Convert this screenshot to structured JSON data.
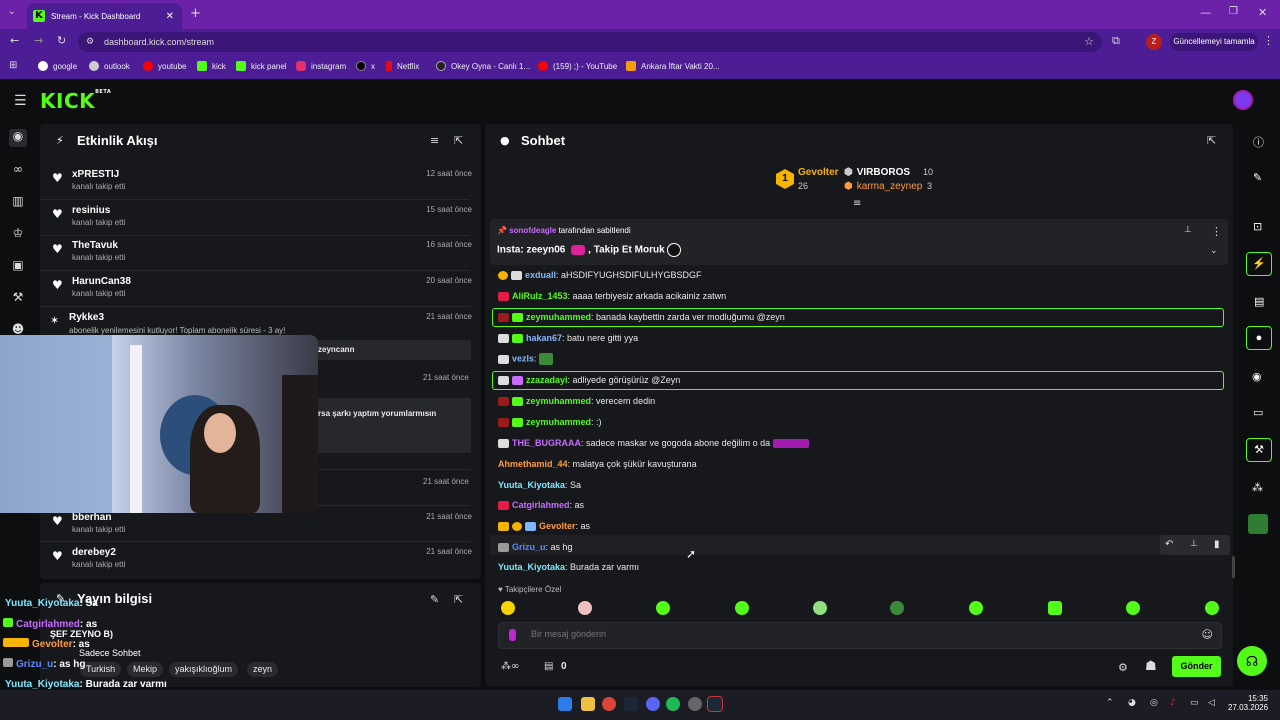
{
  "browser": {
    "tab_title": "Stream - Kick Dashboard",
    "url": "dashboard.kick.com/stream",
    "update_button": "Güncellemeyi tamamla",
    "profile_initial": "Z",
    "bookmarks": [
      "google",
      "outlook",
      "youtube",
      "kick",
      "kick panel",
      "instagram",
      "x",
      "Netflix",
      "Okey Oyna - Canlı 1...",
      "(159) ;) - YouTube",
      "Ankara İftar Vakti 20..."
    ]
  },
  "kick": {
    "logo": "KICK",
    "logo_badge": "BETA"
  },
  "activity": {
    "title": "Etkinlik Akışı",
    "items": [
      {
        "name": "xPRESTIJ",
        "sub": "kanalı takip etti",
        "time": "12 saat önce"
      },
      {
        "name": "resinius",
        "sub": "kanalı takip etti",
        "time": "15 saat önce"
      },
      {
        "name": "TheTavuk",
        "sub": "kanalı takip etti",
        "time": "16 saat önce"
      },
      {
        "name": "HarunCan38",
        "sub": "kanalı takip etti",
        "time": "20 saat önce"
      },
      {
        "name": "Rykke3",
        "sub": "abonelik yenilemesini kutluyor! Toplam abonelik süresi - 3 ay!",
        "time": "21 saat önce"
      },
      {
        "name": "bberhan",
        "sub": "kanalı takip etti",
        "time": "21 saat önce"
      },
      {
        "name": "derebey2",
        "sub": "kanalı takip etti",
        "time": "21 saat önce"
      }
    ],
    "hidden_fragment_1": "zeyncann",
    "hidden_time_1": "21 saat önce",
    "hidden_fragment_2": "rsa şarkı yaptım yorumlarmısın",
    "hidden_time_2": "21 saat önce"
  },
  "stream_info": {
    "title": "Yayın bilgisi",
    "tags": [
      "Turkish",
      "Mekip",
      "yakışıklıoğlum",
      "zeyn"
    ]
  },
  "chat": {
    "title": "Sohbet",
    "leaderboard": {
      "first": {
        "rank": "1",
        "name": "Gevolter",
        "count": "26"
      },
      "second": {
        "name": "VIRBOROS",
        "count": "10"
      },
      "third": {
        "name": "karma_zeynep",
        "count": "3"
      }
    },
    "pinned": {
      "by_user": "sonofdeagle",
      "by_label": "tarafından sabitlendi",
      "text": "Insta: zeeyn06",
      "text2": ", Takip Et Moruk"
    },
    "messages": [
      {
        "user": "exduall",
        "text": "aHSDIFYUGHSDIFULHYGBSDGF",
        "color": "#7fb8ff"
      },
      {
        "user": "AliRulz_1453",
        "text": "aaaa terbiyesiz arkada acikainiz zatwn",
        "color": "#53fc18"
      },
      {
        "user": "zeymuhammed",
        "text": "banada kaybettin zarda ver modluğumu @zeyn",
        "color": "#53fc18"
      },
      {
        "user": "hakan67",
        "text": "batu nere gitti yya",
        "color": "#7fb8ff"
      },
      {
        "user": "vezls",
        "text": "",
        "color": "#7fb8ff"
      },
      {
        "user": "zzazadayi",
        "text": "adliyede görüşürüz @Zeyn",
        "color": "#53fc18"
      },
      {
        "user": "zeymuhammed",
        "text": "verecem dedin",
        "color": "#53fc18"
      },
      {
        "user": "zeymuhammed",
        "text": ":)",
        "color": "#53fc18"
      },
      {
        "user": "THE_BUGRAAA",
        "text": "sadece maskar ve gogoda abone değilim o da",
        "color": "#c86bff"
      },
      {
        "user": "Ahmethamid_44",
        "text": "malatya çok şükür kavuşturana",
        "color": "#ff9b3c"
      },
      {
        "user": "Yuuta_Kiyotaka",
        "text": "Sa",
        "color": "#7fe8ff"
      },
      {
        "user": "Catgirlahmed",
        "text": "as",
        "color": "#c86bff"
      },
      {
        "user": "Gevolter",
        "text": "as",
        "color": "#ff9b3c"
      },
      {
        "user": "Grizu_u",
        "text": "as hg",
        "color": "#5b8bff"
      },
      {
        "user": "Yuuta_Kiyotaka",
        "text": "Burada zar varmı",
        "color": "#7fe8ff"
      }
    ],
    "emote_label": "Takipçilere Özel",
    "input_placeholder": "Bir mesaj gönderin",
    "points": "0",
    "send_label": "Gönder"
  },
  "overlay": {
    "lines": [
      {
        "user": "Yuuta_Kiyotaka",
        "text": ": Sa"
      },
      {
        "user": "Catgirlahmed",
        "text": ": as"
      },
      {
        "user": "",
        "text": "ŞEF ZEYNO B)"
      },
      {
        "user": "Gevolter",
        "text": ": as"
      },
      {
        "user": "",
        "text": "Sadece Sohbet"
      },
      {
        "user": "Grizu_u",
        "text": ": as hg"
      },
      {
        "user": "Yuuta_Kiyotaka",
        "text": ": Burada zar varmı"
      }
    ]
  },
  "taskbar": {
    "time": "15:35",
    "date": "27.03.2026"
  }
}
